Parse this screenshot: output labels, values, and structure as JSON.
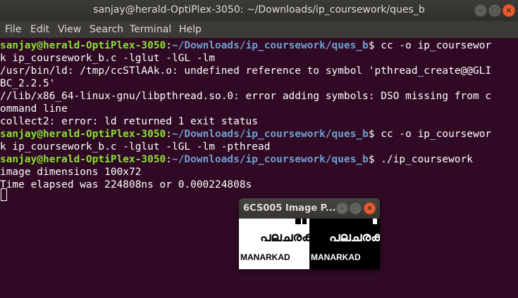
{
  "window": {
    "title": "sanjay@herald-OptiPlex-3050: ~/Downloads/ip_coursework/ques_b",
    "controls": [
      "minimize",
      "maximize",
      "close"
    ]
  },
  "menu": [
    "File",
    "Edit",
    "View",
    "Search",
    "Terminal",
    "Help"
  ],
  "terminal": {
    "prompt_user": "sanjay@herald-OptiPlex-3050",
    "prompt_path": "~/Downloads/ip_coursework/ques_b",
    "lines": [
      {
        "type": "prompt",
        "cmd": " cc -o ip_coursewor"
      },
      {
        "type": "out",
        "text": "k ip_coursework_b.c -lglut -lGL -lm"
      },
      {
        "type": "out",
        "text": "/usr/bin/ld: /tmp/ccSTlAAk.o: undefined reference to symbol 'pthread_create@@GLI"
      },
      {
        "type": "out",
        "text": "BC_2.2.5'"
      },
      {
        "type": "out",
        "text": "//lib/x86_64-linux-gnu/libpthread.so.0: error adding symbols: DSO missing from c"
      },
      {
        "type": "out",
        "text": "ommand line"
      },
      {
        "type": "out",
        "text": "collect2: error: ld returned 1 exit status"
      },
      {
        "type": "prompt",
        "cmd": " cc -o ip_coursewor"
      },
      {
        "type": "out",
        "text": "k ip_coursework_b.c -lglut -lGL -lm -pthread"
      },
      {
        "type": "prompt",
        "cmd": " ./ip_coursework"
      },
      {
        "type": "out",
        "text": "image dimensions 100x72"
      },
      {
        "type": "out",
        "text": "Time elapsed was 224808ns or 0.000224808s"
      }
    ]
  },
  "image_window": {
    "title": "6CS005 Image P...",
    "malayalam_text": "പലചരക്ക്",
    "latin_text": "MANARKAD"
  }
}
